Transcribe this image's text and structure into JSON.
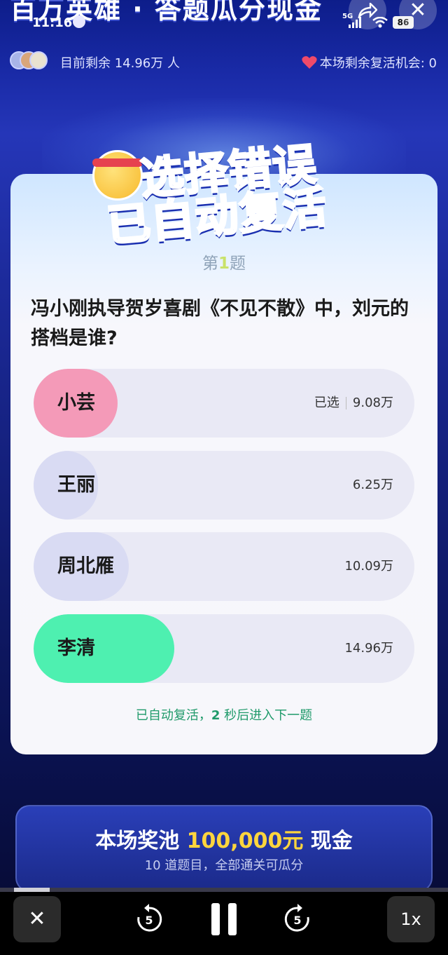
{
  "header": {
    "title": "百万英雄 · 答题瓜分现金",
    "time": "11:16",
    "network": "5G",
    "battery": "86",
    "remaining_text": "目前剩余 14.96万 人",
    "revive_text": "本场剩余复活机会: 0"
  },
  "banner": {
    "line1": "选择错误",
    "line2": "已自动复活"
  },
  "question": {
    "number_prefix": "第",
    "number": "1",
    "number_suffix": "题",
    "text": "冯小刚执导贺岁喜剧《不见不散》中，刘元的搭档是谁?"
  },
  "options": [
    {
      "label": "小芸",
      "selected_tag": "已选",
      "count": "9.08万",
      "fill_fraction": 0.22,
      "fill_color": "#f49ab8"
    },
    {
      "label": "王丽",
      "selected_tag": "",
      "count": "6.25万",
      "fill_fraction": 0.17,
      "fill_color": "#d9dbf3"
    },
    {
      "label": "周北雁",
      "selected_tag": "",
      "count": "10.09万",
      "fill_fraction": 0.25,
      "fill_color": "#d9dbf3"
    },
    {
      "label": "李清",
      "selected_tag": "",
      "count": "14.96万",
      "fill_fraction": 0.37,
      "fill_color": "#4ef0b0"
    }
  ],
  "auto_message": {
    "prefix": "已自动复活，",
    "seconds": "2",
    "suffix": " 秒后进入下一题"
  },
  "prize": {
    "prefix": "本场奖池 ",
    "amount": "100,000元",
    "suffix": " 现金",
    "sub": "10 道题目，全部通关可瓜分"
  },
  "player": {
    "close_label": "✕",
    "rewind_label": "5",
    "forward_label": "5",
    "speed_label": "1x",
    "progress_fraction": 0.08
  },
  "colors": {
    "accent_blue": "#2a52e8",
    "correct_green": "#4ef0b0",
    "selected_pink": "#f49ab8",
    "prize_gold": "#ffd53d"
  }
}
